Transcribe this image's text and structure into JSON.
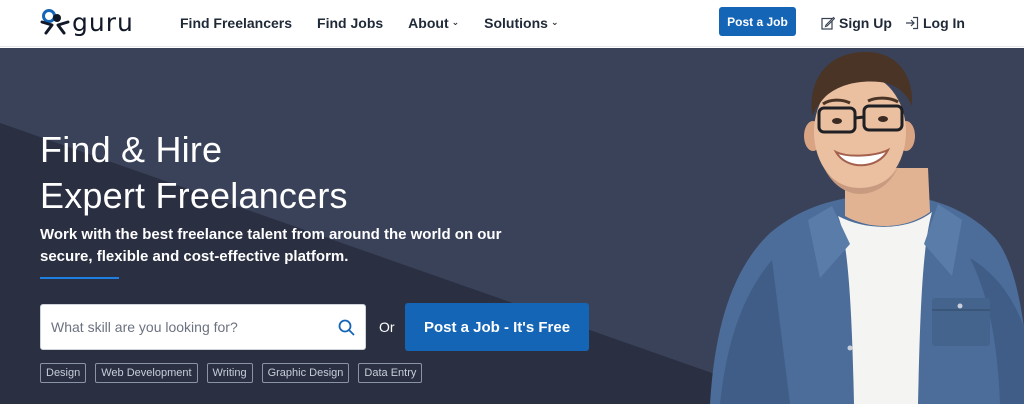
{
  "header": {
    "logo_text": "guru",
    "nav": [
      {
        "label": "Find Freelancers",
        "has_dropdown": false
      },
      {
        "label": "Find Jobs",
        "has_dropdown": false
      },
      {
        "label": "About",
        "has_dropdown": true
      },
      {
        "label": "Solutions",
        "has_dropdown": true
      }
    ],
    "post_job_label": "Post a Job",
    "sign_up_label": "Sign Up",
    "log_in_label": "Log In"
  },
  "hero": {
    "title_line1": "Find & Hire",
    "title_line2": "Expert Freelancers",
    "subtitle": "Work with the best freelance talent from around the world on our secure, flexible and cost-effective platform.",
    "search_placeholder": "What skill are you looking for?",
    "search_value": "",
    "or_label": "Or",
    "post_job_free_label": "Post a Job - It's Free",
    "tags": [
      "Design",
      "Web Development",
      "Writing",
      "Graphic Design",
      "Data Entry"
    ]
  },
  "colors": {
    "brand_blue": "#1565b7",
    "hero_bg": "#2e3448",
    "accent_line": "#1f7fe0"
  },
  "icons": {
    "logo": "guru-logo-icon",
    "search": "search-icon",
    "sign_up": "edit-icon",
    "log_in": "login-icon",
    "dropdown": "chevron-down-icon"
  }
}
